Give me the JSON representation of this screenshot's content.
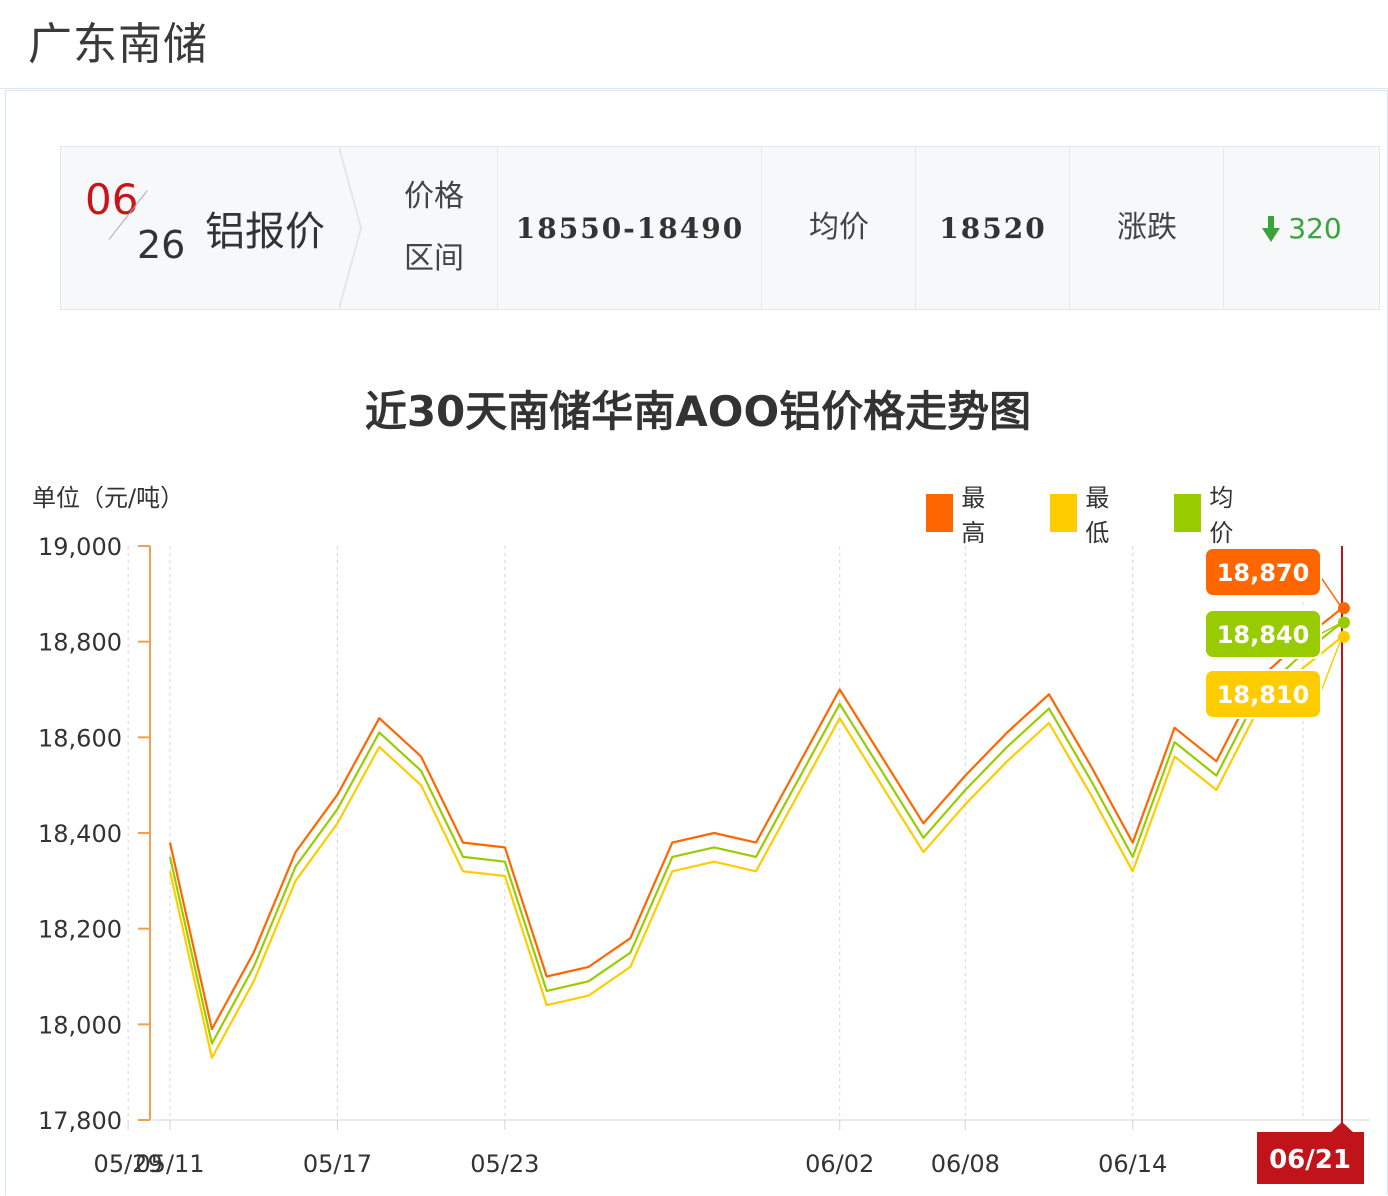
{
  "header": {
    "title": "广东南储"
  },
  "quote": {
    "month": "06",
    "day": "26",
    "name": "铝报价",
    "range_label_line1": "价格",
    "range_label_line2": "区间",
    "range_value": "18550-18490",
    "avg_label": "均价",
    "avg_value": "18520",
    "change_label": "涨跌",
    "change_value": "320",
    "change_direction": "down",
    "change_color": "#3aa33a",
    "change_icon": "arrow-down-icon"
  },
  "chart_data": {
    "type": "line",
    "title": "近30天南储华南AOO铝价格走势图",
    "ylabel": "单位（元/吨）",
    "ylim": [
      17800,
      19000
    ],
    "yticks": [
      "19,000",
      "18,800",
      "18,600",
      "18,400",
      "18,200",
      "18,000",
      "17,800"
    ],
    "ytick_values": [
      19000,
      18800,
      18600,
      18400,
      18200,
      18000,
      17800
    ],
    "xtick_labels": [
      "05/11",
      "05/17",
      "05/23",
      "05/29",
      "06/02",
      "06/08",
      "06/14",
      "06/21"
    ],
    "x": [
      "05/11",
      "05/12",
      "05/13",
      "05/16",
      "05/17",
      "05/18",
      "05/19",
      "05/20",
      "05/23",
      "05/24",
      "05/25",
      "05/26",
      "05/27",
      "05/30",
      "05/31",
      "06/01",
      "06/02",
      "06/06",
      "06/07",
      "06/08",
      "06/09",
      "06/10",
      "06/13",
      "06/14",
      "06/15",
      "06/16",
      "06/17",
      "06/20",
      "06/21"
    ],
    "grid": "vertical-dashed",
    "legend_position": "top-right",
    "series": [
      {
        "name": "最高",
        "color": "#ff6600",
        "values": [
          18380,
          17990,
          18150,
          18360,
          18480,
          18640,
          18560,
          18380,
          18370,
          18100,
          18120,
          18180,
          18380,
          18400,
          18380,
          18540,
          18700,
          18560,
          18420,
          18520,
          18610,
          18690,
          18540,
          18380,
          18620,
          18550,
          18720,
          18800,
          18870
        ]
      },
      {
        "name": "均价",
        "color": "#99cc00",
        "values": [
          18350,
          17960,
          18120,
          18330,
          18450,
          18610,
          18530,
          18350,
          18340,
          18070,
          18090,
          18150,
          18350,
          18370,
          18350,
          18510,
          18670,
          18530,
          18390,
          18490,
          18580,
          18660,
          18510,
          18350,
          18590,
          18520,
          18690,
          18770,
          18840
        ]
      },
      {
        "name": "最低",
        "color": "#ffcc00",
        "values": [
          18320,
          17930,
          18090,
          18300,
          18420,
          18580,
          18500,
          18320,
          18310,
          18040,
          18060,
          18120,
          18320,
          18340,
          18320,
          18480,
          18640,
          18500,
          18360,
          18460,
          18550,
          18630,
          18480,
          18320,
          18560,
          18490,
          18660,
          18740,
          18810
        ]
      }
    ],
    "tooltip": {
      "date": "06/21",
      "values": [
        "18,870",
        "18,840",
        "18,810"
      ],
      "colors": [
        "#ff6600",
        "#99cc00",
        "#ffcc00"
      ]
    },
    "axis_color": "#f0a050",
    "crosshair_color": "#c0141a"
  }
}
